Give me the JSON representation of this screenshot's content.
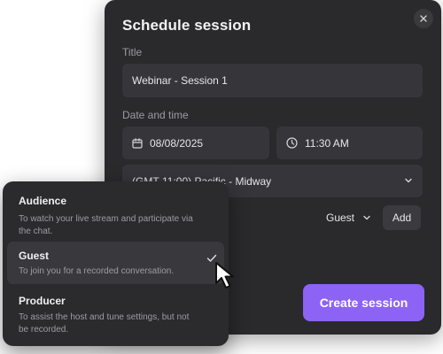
{
  "modal": {
    "title": "Schedule session",
    "close_icon": "close-icon",
    "title_label": "Title",
    "title_value": "Webinar - Session 1",
    "datetime_label": "Date and time",
    "date_value": "08/08/2025",
    "time_value": "11:30 AM",
    "timezone_value": "(GMT-11:00) Pacific - Midway",
    "role_value": "Guest",
    "add_label": "Add",
    "create_label": "Create session"
  },
  "role_menu": {
    "items": [
      {
        "title": "Audience",
        "description": "To watch your live stream and participate via the chat.",
        "selected": false
      },
      {
        "title": "Guest",
        "description": "To join you for a recorded conversation.",
        "selected": true
      },
      {
        "title": "Producer",
        "description": "To assist the host and tune settings, but not be recorded.",
        "selected": false
      }
    ]
  },
  "colors": {
    "accent": "#8c63f5",
    "panel": "#2a2a2c",
    "field": "#36363a"
  }
}
